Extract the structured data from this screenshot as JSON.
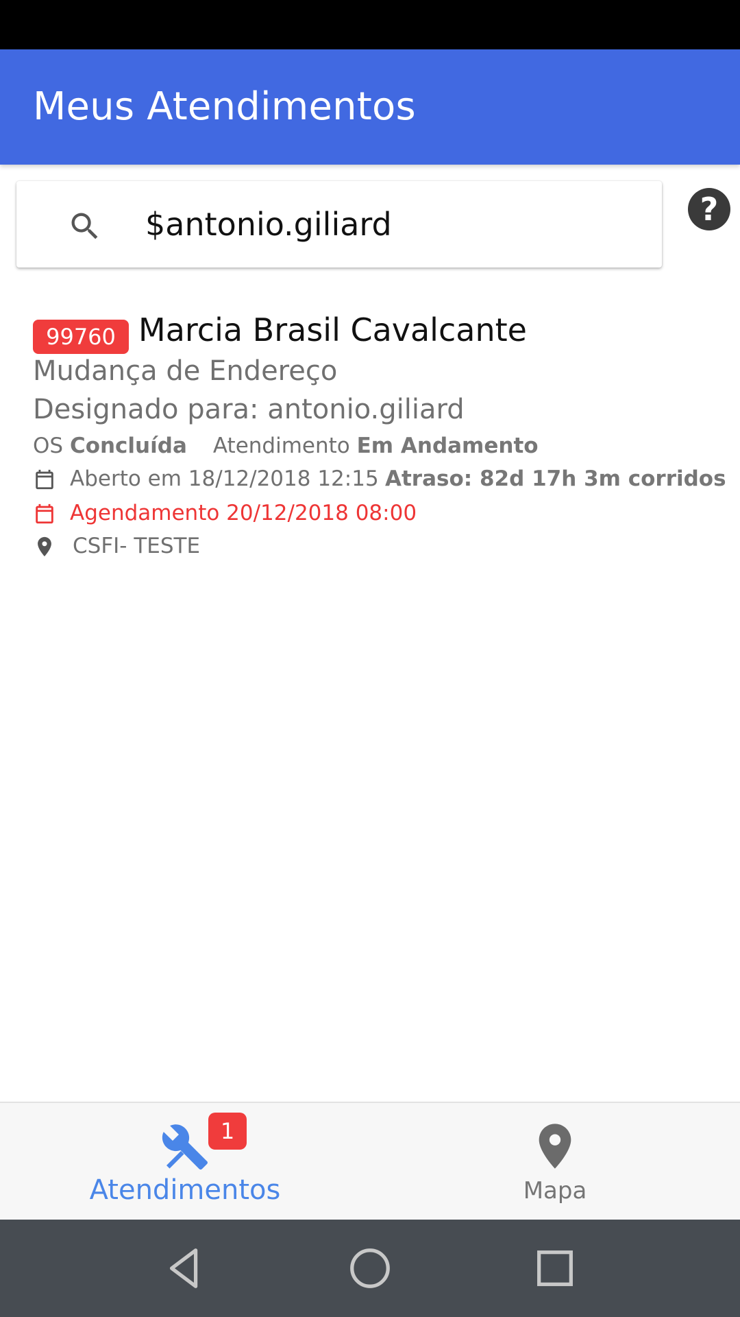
{
  "app": {
    "title": "Meus Atendimentos"
  },
  "search": {
    "value": "$antonio.giliard",
    "placeholder": ""
  },
  "help": {
    "label": "?"
  },
  "items": [
    {
      "id": "99760",
      "customer": "Marcia Brasil Cavalcante",
      "service": "Mudança de Endereço",
      "assigned_prefix": "Designado para: ",
      "assigned_to": "antonio.giliard",
      "os_label": "OS ",
      "os_status": "Concluída",
      "atendimento_label": "Atendimento ",
      "atendimento_status": "Em Andamento",
      "opened": "Aberto em 18/12/2018 12:15",
      "delay": "Atraso: 82d 17h 3m corridos",
      "schedule": "Agendamento 20/12/2018 08:00",
      "location": "CSFI- TESTE"
    }
  ],
  "bottom_nav": {
    "tabs": [
      {
        "label": "Atendimentos",
        "icon": "tools-icon",
        "badge": "1",
        "active": true
      },
      {
        "label": "Mapa",
        "icon": "map-pin-icon",
        "active": false
      }
    ]
  },
  "colors": {
    "app_bar": "#4169e1",
    "badge": "#f03c3c",
    "active_tab": "#4a86e8",
    "schedule": "#ee3535"
  }
}
